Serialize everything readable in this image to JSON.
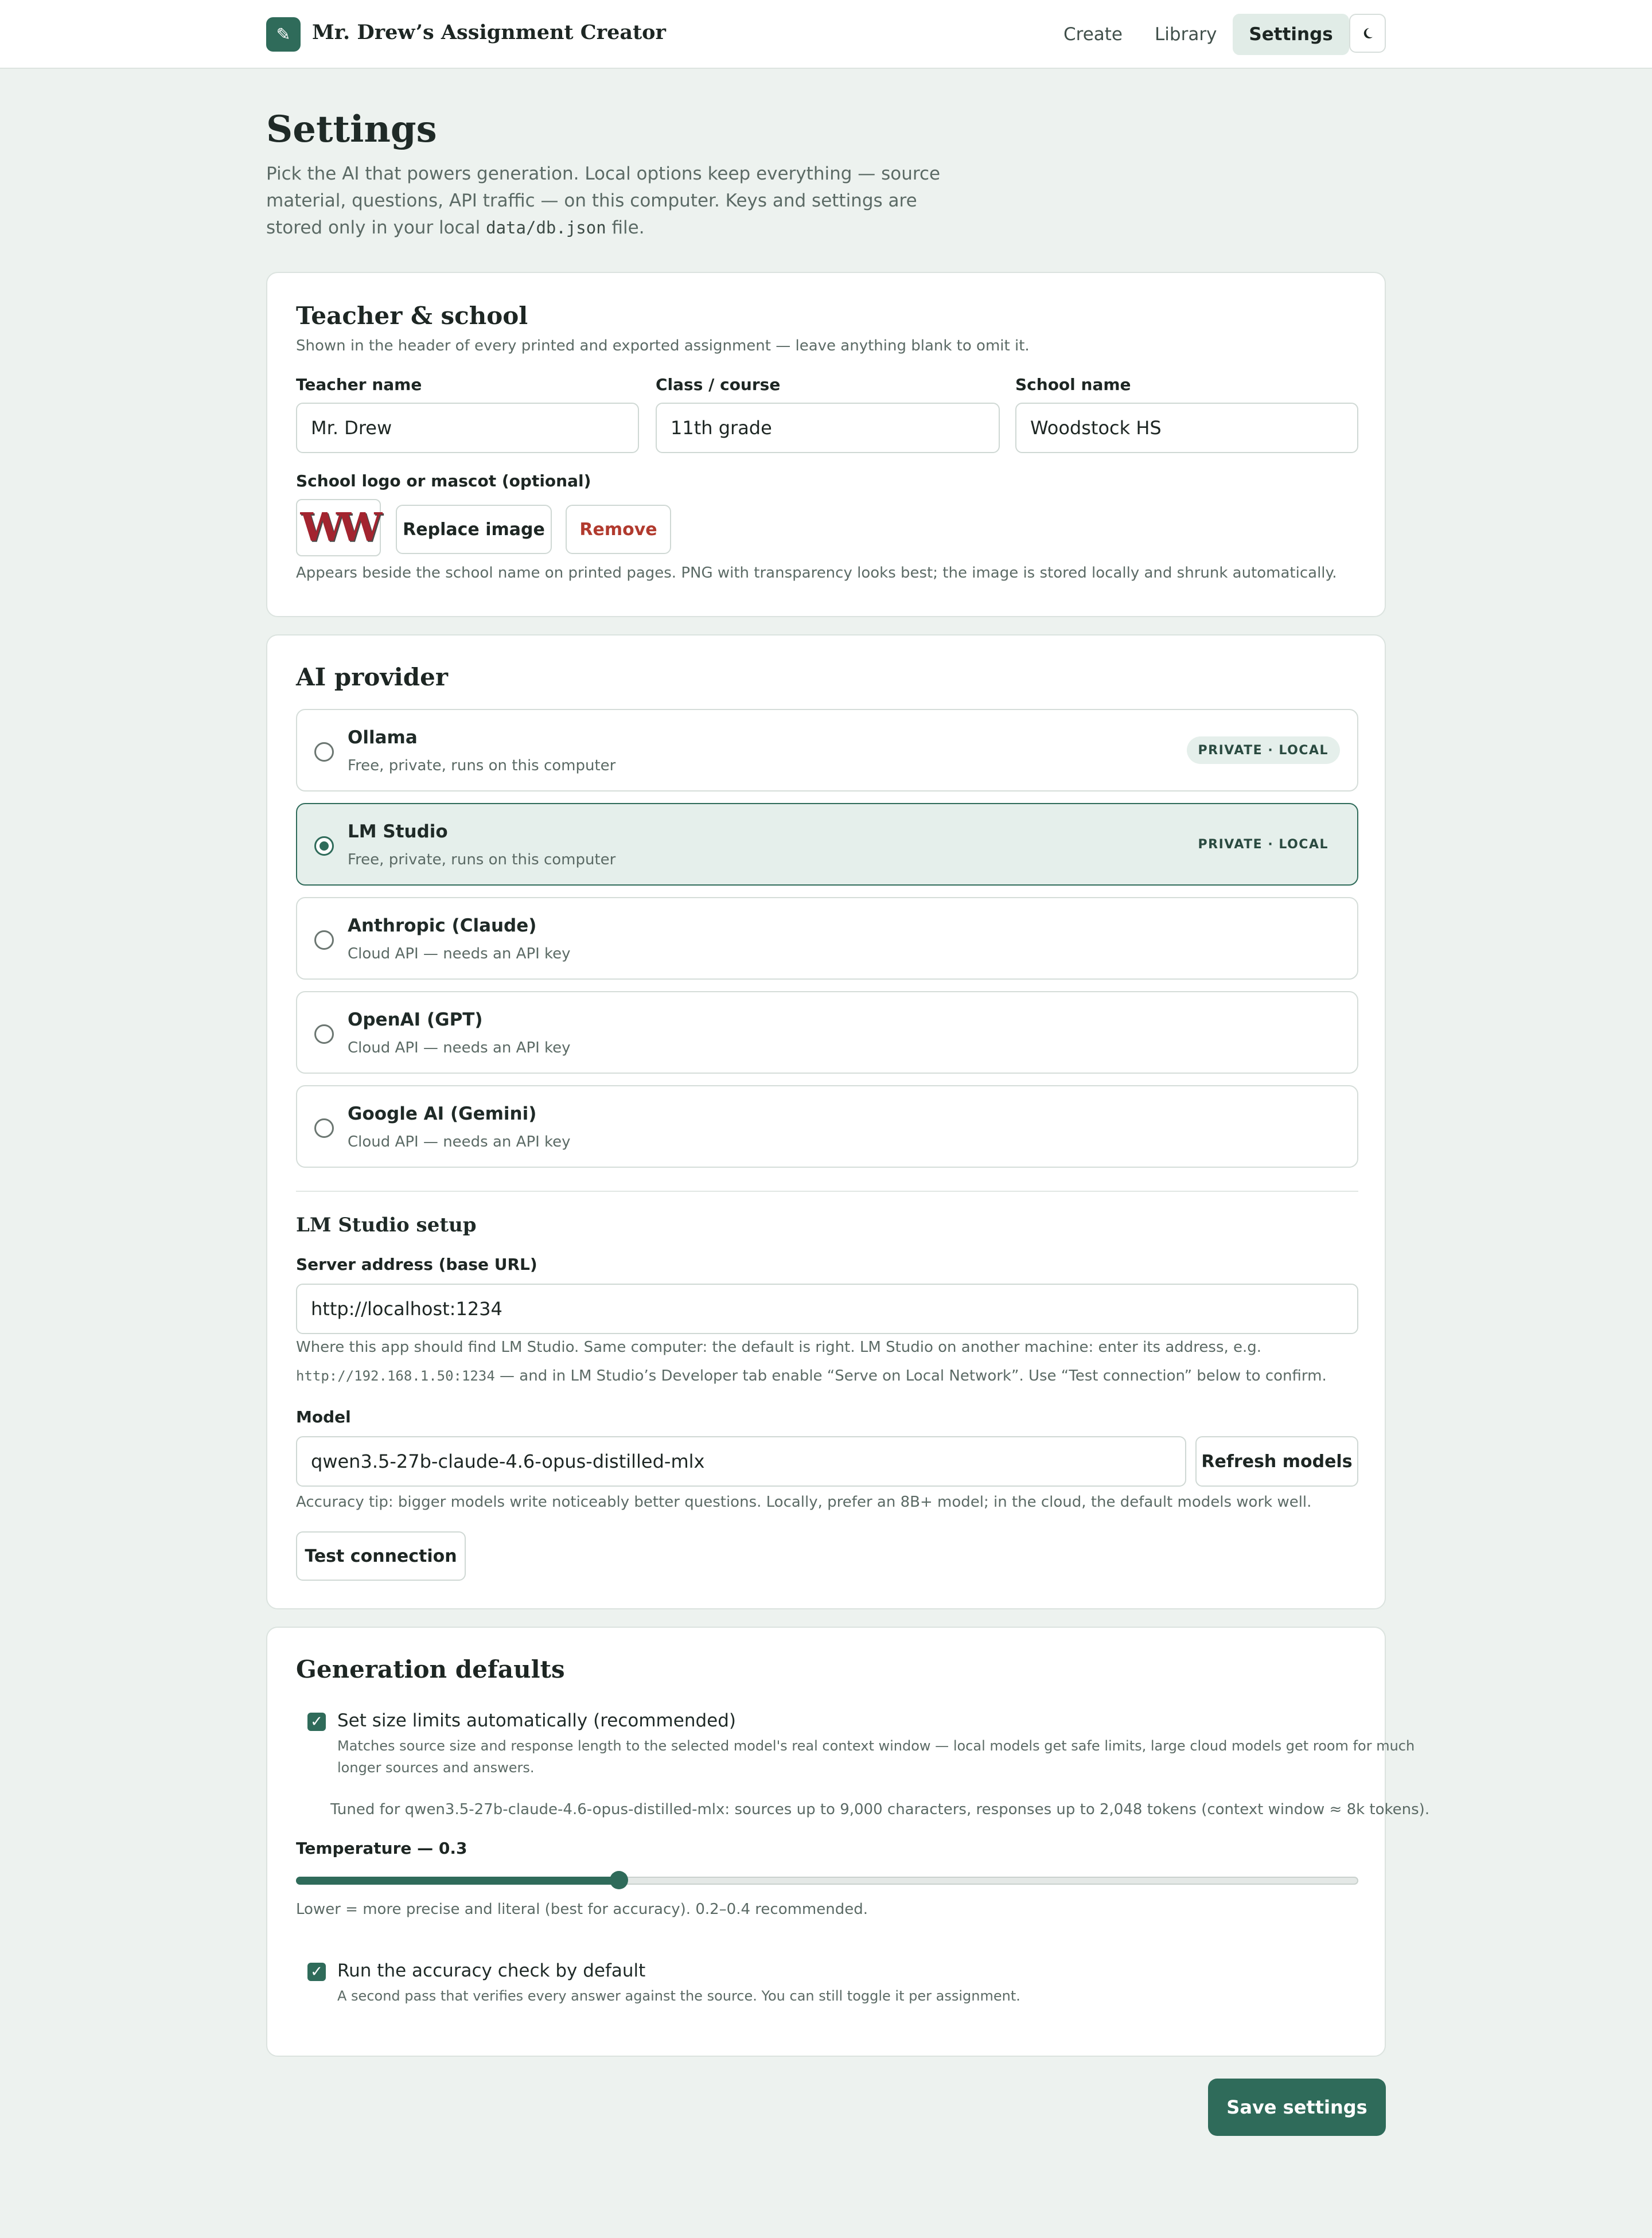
{
  "app": {
    "brand_icon": "pencil-icon",
    "brand_glyph": "✎",
    "title": "Mr. Drew’s Assignment Creator"
  },
  "nav": {
    "items": [
      {
        "label": "Create",
        "active": false
      },
      {
        "label": "Library",
        "active": false
      },
      {
        "label": "Settings",
        "active": true
      }
    ],
    "theme_toggle_icon": "moon-icon"
  },
  "page": {
    "title": "Settings",
    "desc_before": "Pick the AI that powers generation. Local options keep everything — source material, questions, API traffic — on this computer. Keys and settings are stored only in your local ",
    "desc_code": "data/db.json",
    "desc_after": " file."
  },
  "teacher": {
    "title": "Teacher & school",
    "subtitle": "Shown in the header of every printed and exported assignment — leave anything blank to omit it.",
    "teacher_name_label": "Teacher name",
    "teacher_name_value": "Mr. Drew",
    "class_label": "Class / course",
    "class_value": "11th grade",
    "school_label": "School name",
    "school_value": "Woodstock HS",
    "logo_label": "School logo or mascot (optional)",
    "logo_text": "WW",
    "replace_label": "Replace image",
    "remove_label": "Remove",
    "logo_help": "Appears beside the school name on printed pages. PNG with transparency looks best; the image is stored locally and shrunk automatically."
  },
  "provider": {
    "title": "AI provider",
    "options": [
      {
        "name": "Ollama",
        "desc": "Free, private, runs on this computer",
        "badge": "PRIVATE · LOCAL",
        "selected": false
      },
      {
        "name": "LM Studio",
        "desc": "Free, private, runs on this computer",
        "badge": "PRIVATE · LOCAL",
        "selected": true
      },
      {
        "name": "Anthropic (Claude)",
        "desc": "Cloud API — needs an API key",
        "badge": "",
        "selected": false
      },
      {
        "name": "OpenAI (GPT)",
        "desc": "Cloud API — needs an API key",
        "badge": "",
        "selected": false
      },
      {
        "name": "Google AI (Gemini)",
        "desc": "Cloud API — needs an API key",
        "badge": "",
        "selected": false
      }
    ],
    "setup_title": "LM Studio setup",
    "server_label": "Server address (base URL)",
    "server_value": "http://localhost:1234",
    "server_help_1": "Where this app should find LM Studio. Same computer: the default is right. LM Studio on another machine: enter its address, e.g.",
    "server_help_code": "http://192.168.1.50:1234",
    "server_help_2": " — and in LM Studio’s Developer tab enable “Serve on Local Network”. Use “Test connection” below to confirm.",
    "model_label": "Model",
    "model_value": "qwen3.5-27b-claude-4.6-opus-distilled-mlx",
    "refresh_label": "Refresh models",
    "model_help": "Accuracy tip: bigger models write noticeably better questions. Locally, prefer an 8B+ model; in the cloud, the default models work well.",
    "test_label": "Test connection"
  },
  "generation": {
    "title": "Generation defaults",
    "auto_limits_label": "Set size limits automatically (recommended)",
    "auto_limits_checked": true,
    "auto_limits_help_1": "Matches source size and response length to the selected model's real context window — local models get safe limits, large cloud models get room for much",
    "auto_limits_help_2": "longer sources and answers.",
    "tuned_note": "Tuned for qwen3.5-27b-claude-4.6-opus-distilled-mlx: sources up to 9,000 characters, responses up to 2,048 tokens (context window ≈ 8k tokens).",
    "temperature_label": "Temperature — 0.3",
    "temperature_value": 0.3,
    "temperature_fraction": 0.304,
    "temperature_help": "Lower = more precise and literal (best for accuracy). 0.2–0.4 recommended.",
    "accuracy_label": "Run the accuracy check by default",
    "accuracy_checked": true,
    "accuracy_help": "A second pass that verifies every answer against the source. You can still toggle it per assignment."
  },
  "save_label": "Save settings",
  "colors": {
    "accent": "#2f6b5a",
    "background": "#edf2ef",
    "danger": "#b13a2e"
  }
}
